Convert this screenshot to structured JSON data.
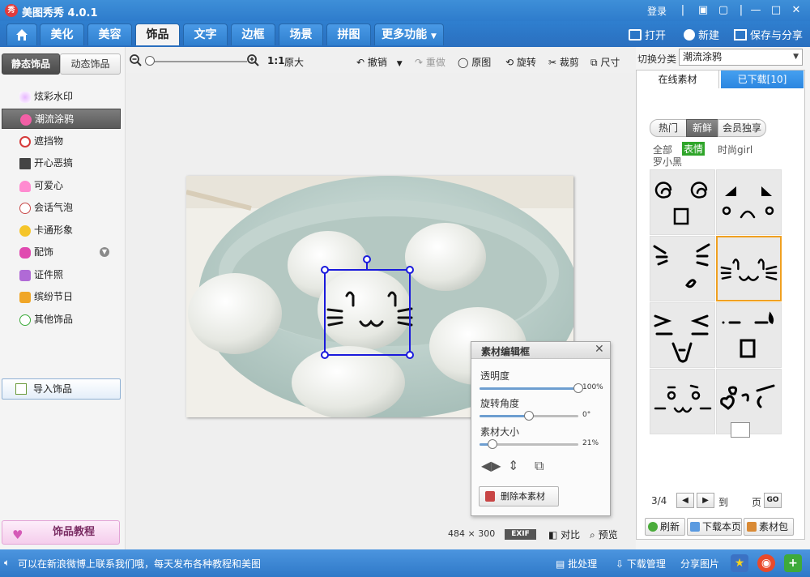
{
  "app": {
    "title": "美图秀秀 4.0.1",
    "login": "登录"
  },
  "tabs": [
    "美化",
    "美容",
    "饰品",
    "文字",
    "边框",
    "场景",
    "拼图",
    "更多功能"
  ],
  "top_actions": {
    "open": "打开",
    "new": "新建",
    "save": "保存与分享"
  },
  "left": {
    "subtabs": [
      "静态饰品",
      "动态饰品"
    ],
    "categories": [
      "炫彩水印",
      "潮流涂鸦",
      "遮挡物",
      "开心恶搞",
      "可爱心",
      "会话气泡",
      "卡通形象",
      "配饰",
      "证件照",
      "缤纷节日",
      "其他饰品"
    ],
    "selected_category": "潮流涂鸦",
    "import_button": "导入饰品",
    "tutorial_button": "饰品教程"
  },
  "toolbar": {
    "ratio": "1:1",
    "original_size": "原大",
    "undo": "撤销",
    "redo": "重做",
    "original": "原图",
    "rotate": "旋转",
    "crop": "裁剪",
    "resize": "尺寸"
  },
  "image": {
    "width": "484",
    "times": "×",
    "height": "300",
    "exif": "EXIF",
    "compare": "对比",
    "preview": "预览"
  },
  "dialog": {
    "title": "素材编辑框",
    "opacity_label": "透明度",
    "opacity_value": "100%",
    "rotation_label": "旋转角度",
    "rotation_value": "0°",
    "size_label": "素材大小",
    "size_value": "21%",
    "delete_button": "删除本素材",
    "opacity_level": 1.0,
    "rotation_level": 0.5,
    "size_level": 0.13
  },
  "right": {
    "switch_label": "切换分类",
    "selected_category": "潮流涂鸦",
    "tabs": [
      "在线素材",
      "已下载[10]"
    ],
    "filters": [
      "热门",
      "新鲜",
      "会员独享"
    ],
    "active_filter": "新鲜",
    "subcats": [
      "全部",
      "表情",
      "时尚girl",
      "罗小黑"
    ],
    "active_subcat": "表情",
    "page": "3/4",
    "goto_label": "到",
    "page_label": "页",
    "go": "GO",
    "refresh": "刷新",
    "download_page": "下载本页",
    "pack": "素材包"
  },
  "status": {
    "message": "可以在新浪微博上联系我们哦，每天发布各种教程和美图",
    "batch": "批处理",
    "download_manager": "下载管理",
    "share": "分享图片"
  }
}
